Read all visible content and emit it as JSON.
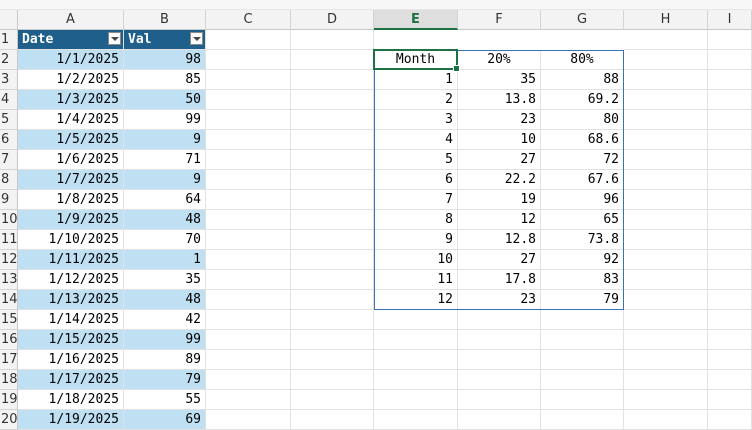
{
  "columns": [
    "A",
    "B",
    "C",
    "D",
    "E",
    "F",
    "G",
    "H",
    "I"
  ],
  "selected_column": "E",
  "row_numbers": [
    "1",
    "2",
    "3",
    "4",
    "5",
    "6",
    "7",
    "8",
    "9",
    "10",
    "11",
    "12",
    "13",
    "14",
    "15",
    "16",
    "17",
    "18",
    "19",
    "20"
  ],
  "table": {
    "headers": [
      "Date",
      "Val"
    ],
    "rows": [
      [
        "1/1/2025",
        "98"
      ],
      [
        "1/2/2025",
        "85"
      ],
      [
        "1/3/2025",
        "50"
      ],
      [
        "1/4/2025",
        "99"
      ],
      [
        "1/5/2025",
        "9"
      ],
      [
        "1/6/2025",
        "71"
      ],
      [
        "1/7/2025",
        "9"
      ],
      [
        "1/8/2025",
        "64"
      ],
      [
        "1/9/2025",
        "48"
      ],
      [
        "1/10/2025",
        "70"
      ],
      [
        "1/11/2025",
        "1"
      ],
      [
        "1/12/2025",
        "35"
      ],
      [
        "1/13/2025",
        "48"
      ],
      [
        "1/14/2025",
        "42"
      ],
      [
        "1/15/2025",
        "99"
      ],
      [
        "1/16/2025",
        "89"
      ],
      [
        "1/17/2025",
        "79"
      ],
      [
        "1/18/2025",
        "55"
      ],
      [
        "1/19/2025",
        "69"
      ]
    ]
  },
  "summary": {
    "headers": [
      "Month",
      "20%",
      "80%"
    ],
    "rows": [
      [
        "1",
        "35",
        "88"
      ],
      [
        "2",
        "13.8",
        "69.2"
      ],
      [
        "3",
        "23",
        "80"
      ],
      [
        "4",
        "10",
        "68.6"
      ],
      [
        "5",
        "27",
        "72"
      ],
      [
        "6",
        "22.2",
        "67.6"
      ],
      [
        "7",
        "19",
        "96"
      ],
      [
        "8",
        "12",
        "65"
      ],
      [
        "9",
        "12.8",
        "73.8"
      ],
      [
        "10",
        "27",
        "92"
      ],
      [
        "11",
        "17.8",
        "83"
      ],
      [
        "12",
        "23",
        "79"
      ]
    ]
  },
  "colors": {
    "table_header": "#1f5f8b",
    "band": "#bfe0f3",
    "selection": "#1e7145",
    "range_border": "#3b6fb6"
  }
}
